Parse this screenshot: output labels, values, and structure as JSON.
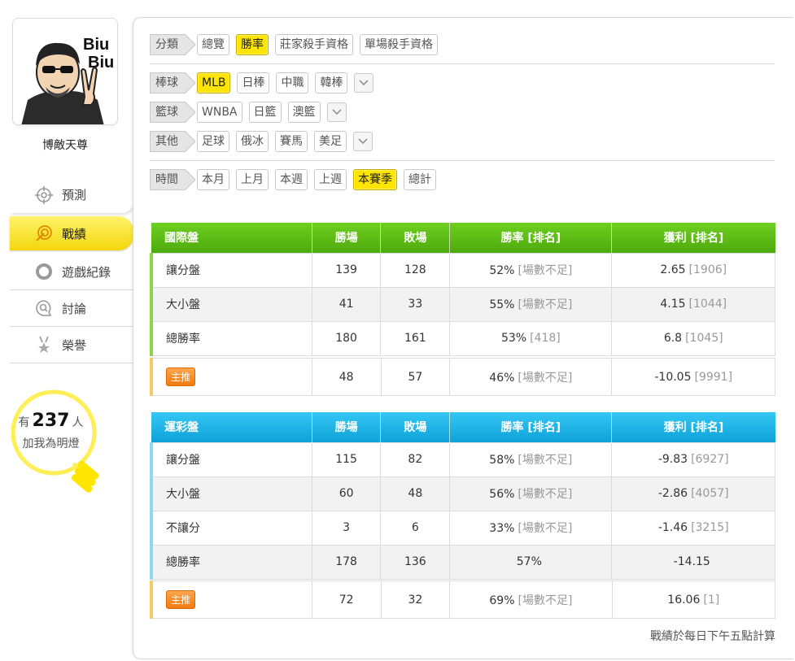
{
  "user": {
    "name": "博敵天尊",
    "avatar_text": [
      "Biu",
      "Biu"
    ]
  },
  "nav": [
    {
      "label": "預測",
      "icon": "target-icon"
    },
    {
      "label": "戰績",
      "icon": "record-icon"
    },
    {
      "label": "遊戲紀錄",
      "icon": "circle-icon"
    },
    {
      "label": "討論",
      "icon": "chat-search-icon"
    },
    {
      "label": "榮譽",
      "icon": "medal-icon"
    }
  ],
  "fans": {
    "prefix": "有",
    "count": "237",
    "suffix": "人",
    "line2": "加我為明燈"
  },
  "filters": {
    "category": {
      "label": "分類",
      "options": [
        "總覽",
        "勝率",
        "莊家殺手資格",
        "單場殺手資格"
      ],
      "active": 1
    },
    "baseball": {
      "label": "棒球",
      "options": [
        "MLB",
        "日棒",
        "中職",
        "韓棒"
      ],
      "active": 0
    },
    "basketball": {
      "label": "籃球",
      "options": [
        "WNBA",
        "日籃",
        "澳籃"
      ],
      "active": -1
    },
    "other": {
      "label": "其他",
      "options": [
        "足球",
        "俄冰",
        "賽馬",
        "美足"
      ],
      "active": -1
    },
    "time": {
      "label": "時間",
      "options": [
        "本月",
        "上月",
        "本週",
        "上週",
        "本賽季",
        "總計"
      ],
      "active": 4
    }
  },
  "table1": {
    "headers": [
      "國際盤",
      "勝場",
      "敗場",
      "勝率 [排名]",
      "獲利 [排名]"
    ],
    "rows": [
      {
        "name": "讓分盤",
        "win": "139",
        "lose": "128",
        "rate": "52%",
        "rate_rank": "[場數不足]",
        "profit": "2.65",
        "profit_rank": "[1906]"
      },
      {
        "name": "大小盤",
        "win": "41",
        "lose": "33",
        "rate": "55%",
        "rate_rank": "[場數不足]",
        "profit": "4.15",
        "profit_rank": "[1044]"
      },
      {
        "name": "總勝率",
        "win": "180",
        "lose": "161",
        "rate": "53%",
        "rate_rank": "[418]",
        "profit": "6.8",
        "profit_rank": "[1045]"
      }
    ],
    "main": {
      "badge": "主推",
      "win": "48",
      "lose": "57",
      "rate": "46%",
      "rate_rank": "[場數不足]",
      "profit": "-10.05",
      "profit_rank": "[9991]"
    }
  },
  "table2": {
    "headers": [
      "運彩盤",
      "勝場",
      "敗場",
      "勝率 [排名]",
      "獲利 [排名]"
    ],
    "rows": [
      {
        "name": "讓分盤",
        "win": "115",
        "lose": "82",
        "rate": "58%",
        "rate_rank": "[場數不足]",
        "profit": "-9.83",
        "profit_rank": "[6927]"
      },
      {
        "name": "大小盤",
        "win": "60",
        "lose": "48",
        "rate": "56%",
        "rate_rank": "[場數不足]",
        "profit": "-2.86",
        "profit_rank": "[4057]"
      },
      {
        "name": "不讓分",
        "win": "3",
        "lose": "6",
        "rate": "33%",
        "rate_rank": "[場數不足]",
        "profit": "-1.46",
        "profit_rank": "[3215]"
      },
      {
        "name": "總勝率",
        "win": "178",
        "lose": "136",
        "rate": "57%",
        "rate_rank": "",
        "profit": "-14.15",
        "profit_rank": ""
      }
    ],
    "main": {
      "badge": "主推",
      "win": "72",
      "lose": "32",
      "rate": "69%",
      "rate_rank": "[場數不足]",
      "profit": "16.06",
      "profit_rank": "[1]"
    }
  },
  "footnote": "戰績於每日下午五點計算",
  "colors": {
    "accent_yellow": "#ffe500",
    "green_header": "#5bbb12",
    "blue_header": "#1db3e6",
    "badge_orange": "#f58a1f"
  }
}
